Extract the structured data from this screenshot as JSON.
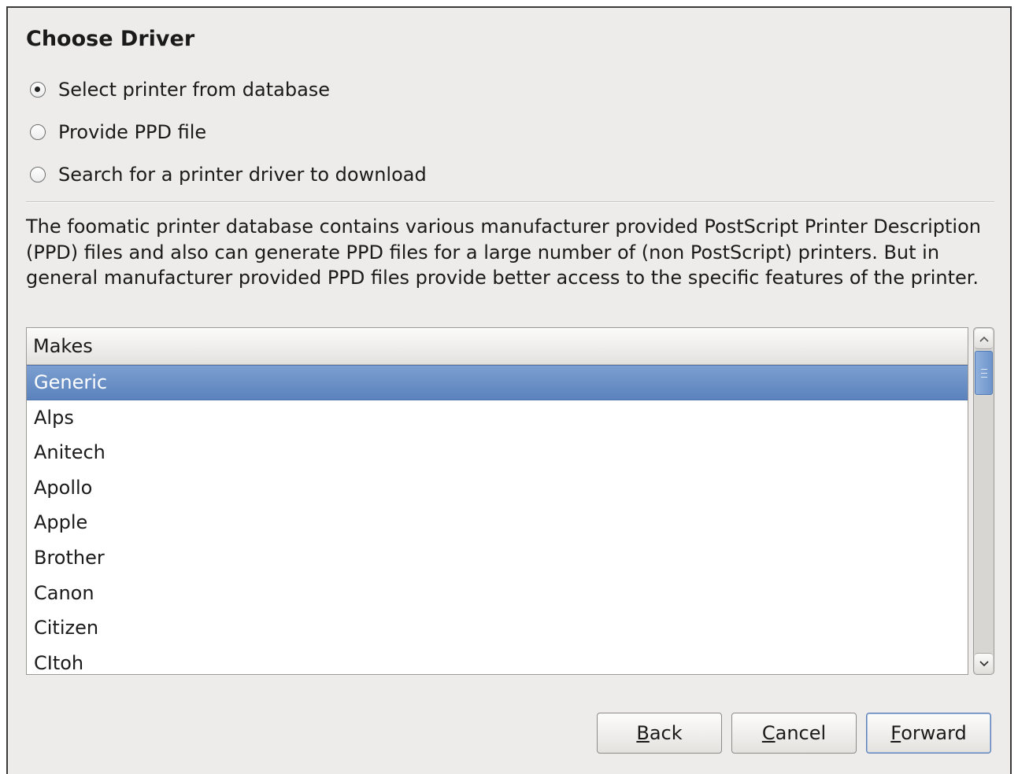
{
  "dialog": {
    "title": "Choose Driver"
  },
  "driver_source": {
    "options": [
      {
        "label": "Select printer from database",
        "checked": true
      },
      {
        "label": "Provide PPD file",
        "checked": false
      },
      {
        "label": "Search for a printer driver to download",
        "checked": false
      }
    ]
  },
  "description": "The foomatic printer database contains various manufacturer provided PostScript Printer Description (PPD) files and also can generate PPD files for a large number of (non PostScript) printers. But in general manufacturer provided PPD files provide better access to the specific features of the printer.",
  "makes_list": {
    "header": "Makes",
    "selected_index": 0,
    "items": [
      "Generic",
      "Alps",
      "Anitech",
      "Apollo",
      "Apple",
      "Brother",
      "Canon",
      "Citizen",
      "CItoh"
    ]
  },
  "buttons": {
    "back": {
      "mnemonic": "B",
      "rest": "ack"
    },
    "cancel": {
      "mnemonic": "C",
      "rest": "ancel"
    },
    "forward": {
      "mnemonic": "F",
      "rest": "orward"
    }
  },
  "icons": {
    "scroll_up": "chevron-up-icon",
    "scroll_down": "chevron-down-icon"
  },
  "colors": {
    "selection": "#6a8fc7",
    "window_bg": "#edeceb"
  }
}
